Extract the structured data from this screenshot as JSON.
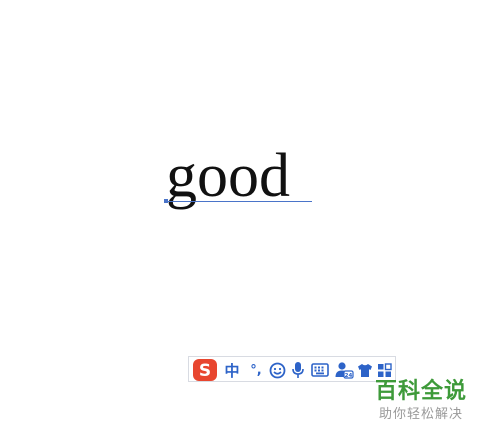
{
  "document": {
    "typed_word": "good"
  },
  "ime_toolbar": {
    "logo_glyph": "S",
    "language_mode": "中",
    "punctuation_mode": "°,",
    "icons": {
      "logo": "sogou-logo-icon",
      "emoji": "smiley-icon",
      "voice": "microphone-icon",
      "keyboard": "keyboard-icon",
      "user": "user-account-icon",
      "skin": "shirt-skin-icon",
      "tools": "toolbox-grid-icon"
    },
    "colors": {
      "accent": "#2d63c8",
      "logo_bg": "#e8462f"
    }
  },
  "watermark": {
    "title": "百科全说",
    "subtitle": "助你轻松解决"
  }
}
